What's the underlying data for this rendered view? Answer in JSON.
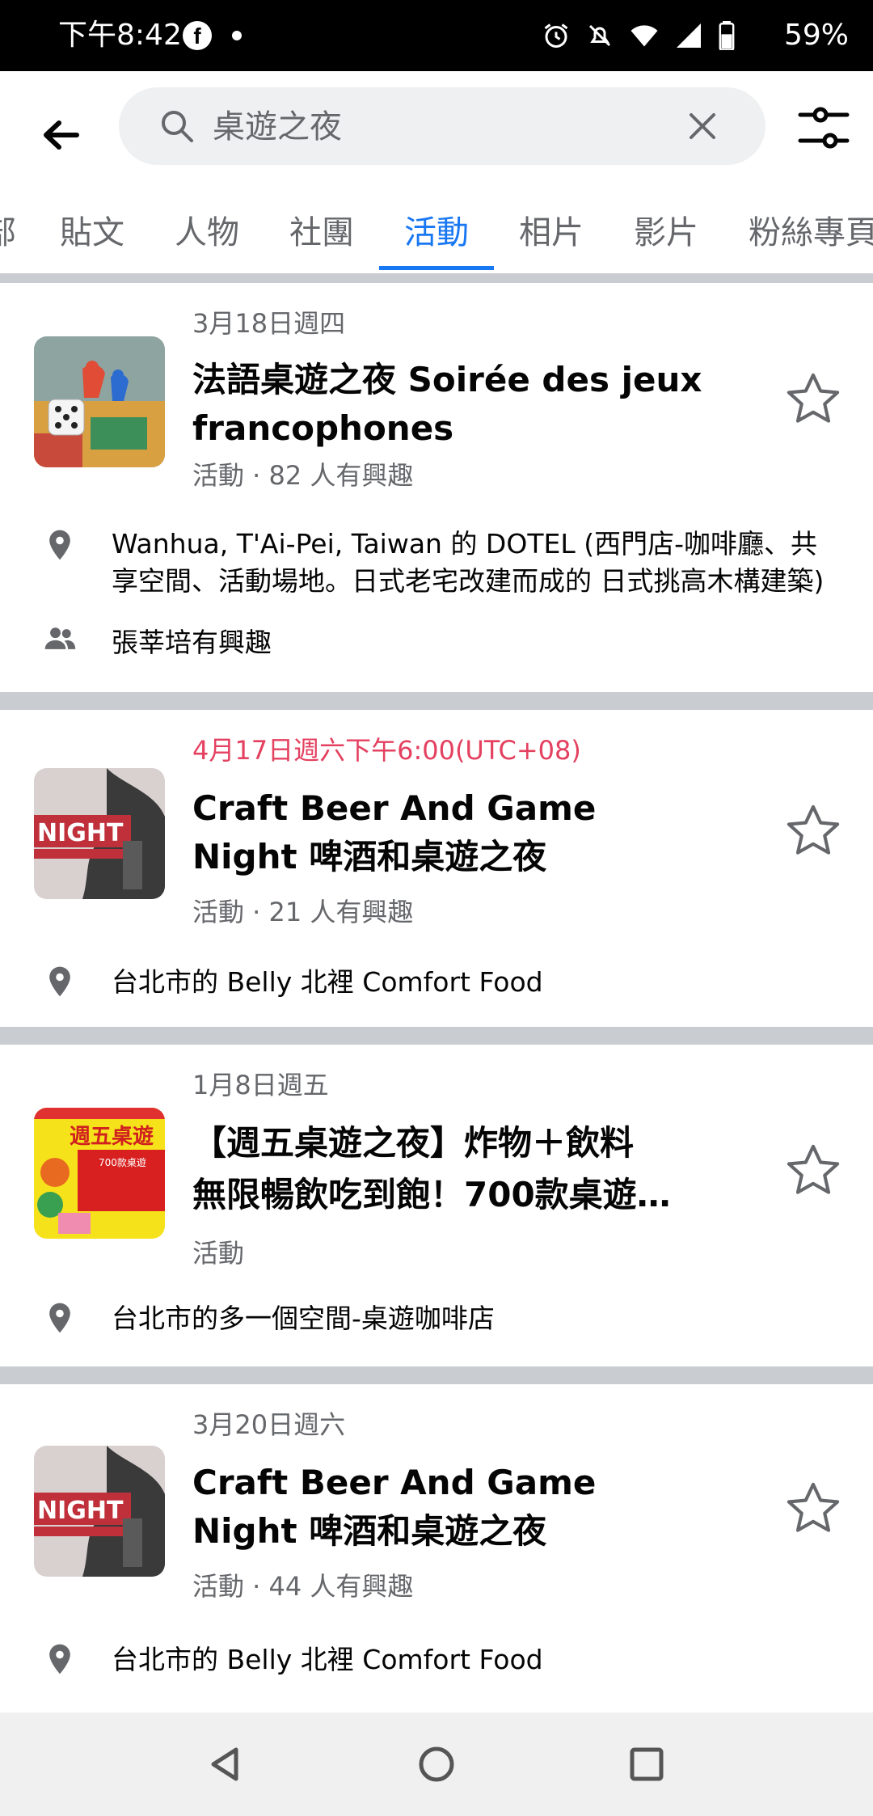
{
  "status_bar": {
    "time": "下午8:42",
    "battery": "59%"
  },
  "search": {
    "query": "桌遊之夜"
  },
  "tabs": [
    {
      "label": "部"
    },
    {
      "label": "貼文"
    },
    {
      "label": "人物"
    },
    {
      "label": "社團"
    },
    {
      "label": "活動"
    },
    {
      "label": "相片"
    },
    {
      "label": "影片"
    },
    {
      "label": "粉絲專頁"
    }
  ],
  "active_tab": "活動",
  "colors": {
    "accent": "#1877f2",
    "date_highlight": "#e4405f",
    "separator": "#c9ccd1",
    "secondary_text": "#65676b"
  },
  "events": [
    {
      "date": "3月18日週四",
      "title": "法語桌遊之夜 Soirée des jeux francophones",
      "meta": "活動 · 82 人有興趣",
      "location": "Wanhua, T'Ai-Pei, Taiwan 的 DOTEL (西門店-咖啡廳、共享空間、活動場地。日式老宅改建而成的 日式挑高木構建築)",
      "friends": "張莘培有興趣"
    },
    {
      "date": "4月17日週六下午6:00(UTC+08)",
      "title": "Craft Beer And Game Night 啤酒和桌遊之夜",
      "meta": "活動 · 21 人有興趣",
      "location": "台北市的 Belly 北裡 Comfort Food"
    },
    {
      "date": "1月8日週五",
      "title_line1": "【週五桌遊之夜】炸物＋飲料",
      "title_line2": "無限暢飲吃到飽！700款桌遊…",
      "meta": "活動",
      "location": "台北市的多一個空間-桌遊咖啡店"
    },
    {
      "date": "3月20日週六",
      "title": "Craft Beer And Game Night 啤酒和桌遊之夜",
      "meta": "活動 · 44 人有興趣",
      "location": "台北市的 Belly 北裡 Comfort Food"
    }
  ],
  "thumbnails": {
    "beer_art_text": "NIGHT",
    "friday_art_text": "週五桌遊",
    "friday_art_sub": "700款桌遊"
  }
}
